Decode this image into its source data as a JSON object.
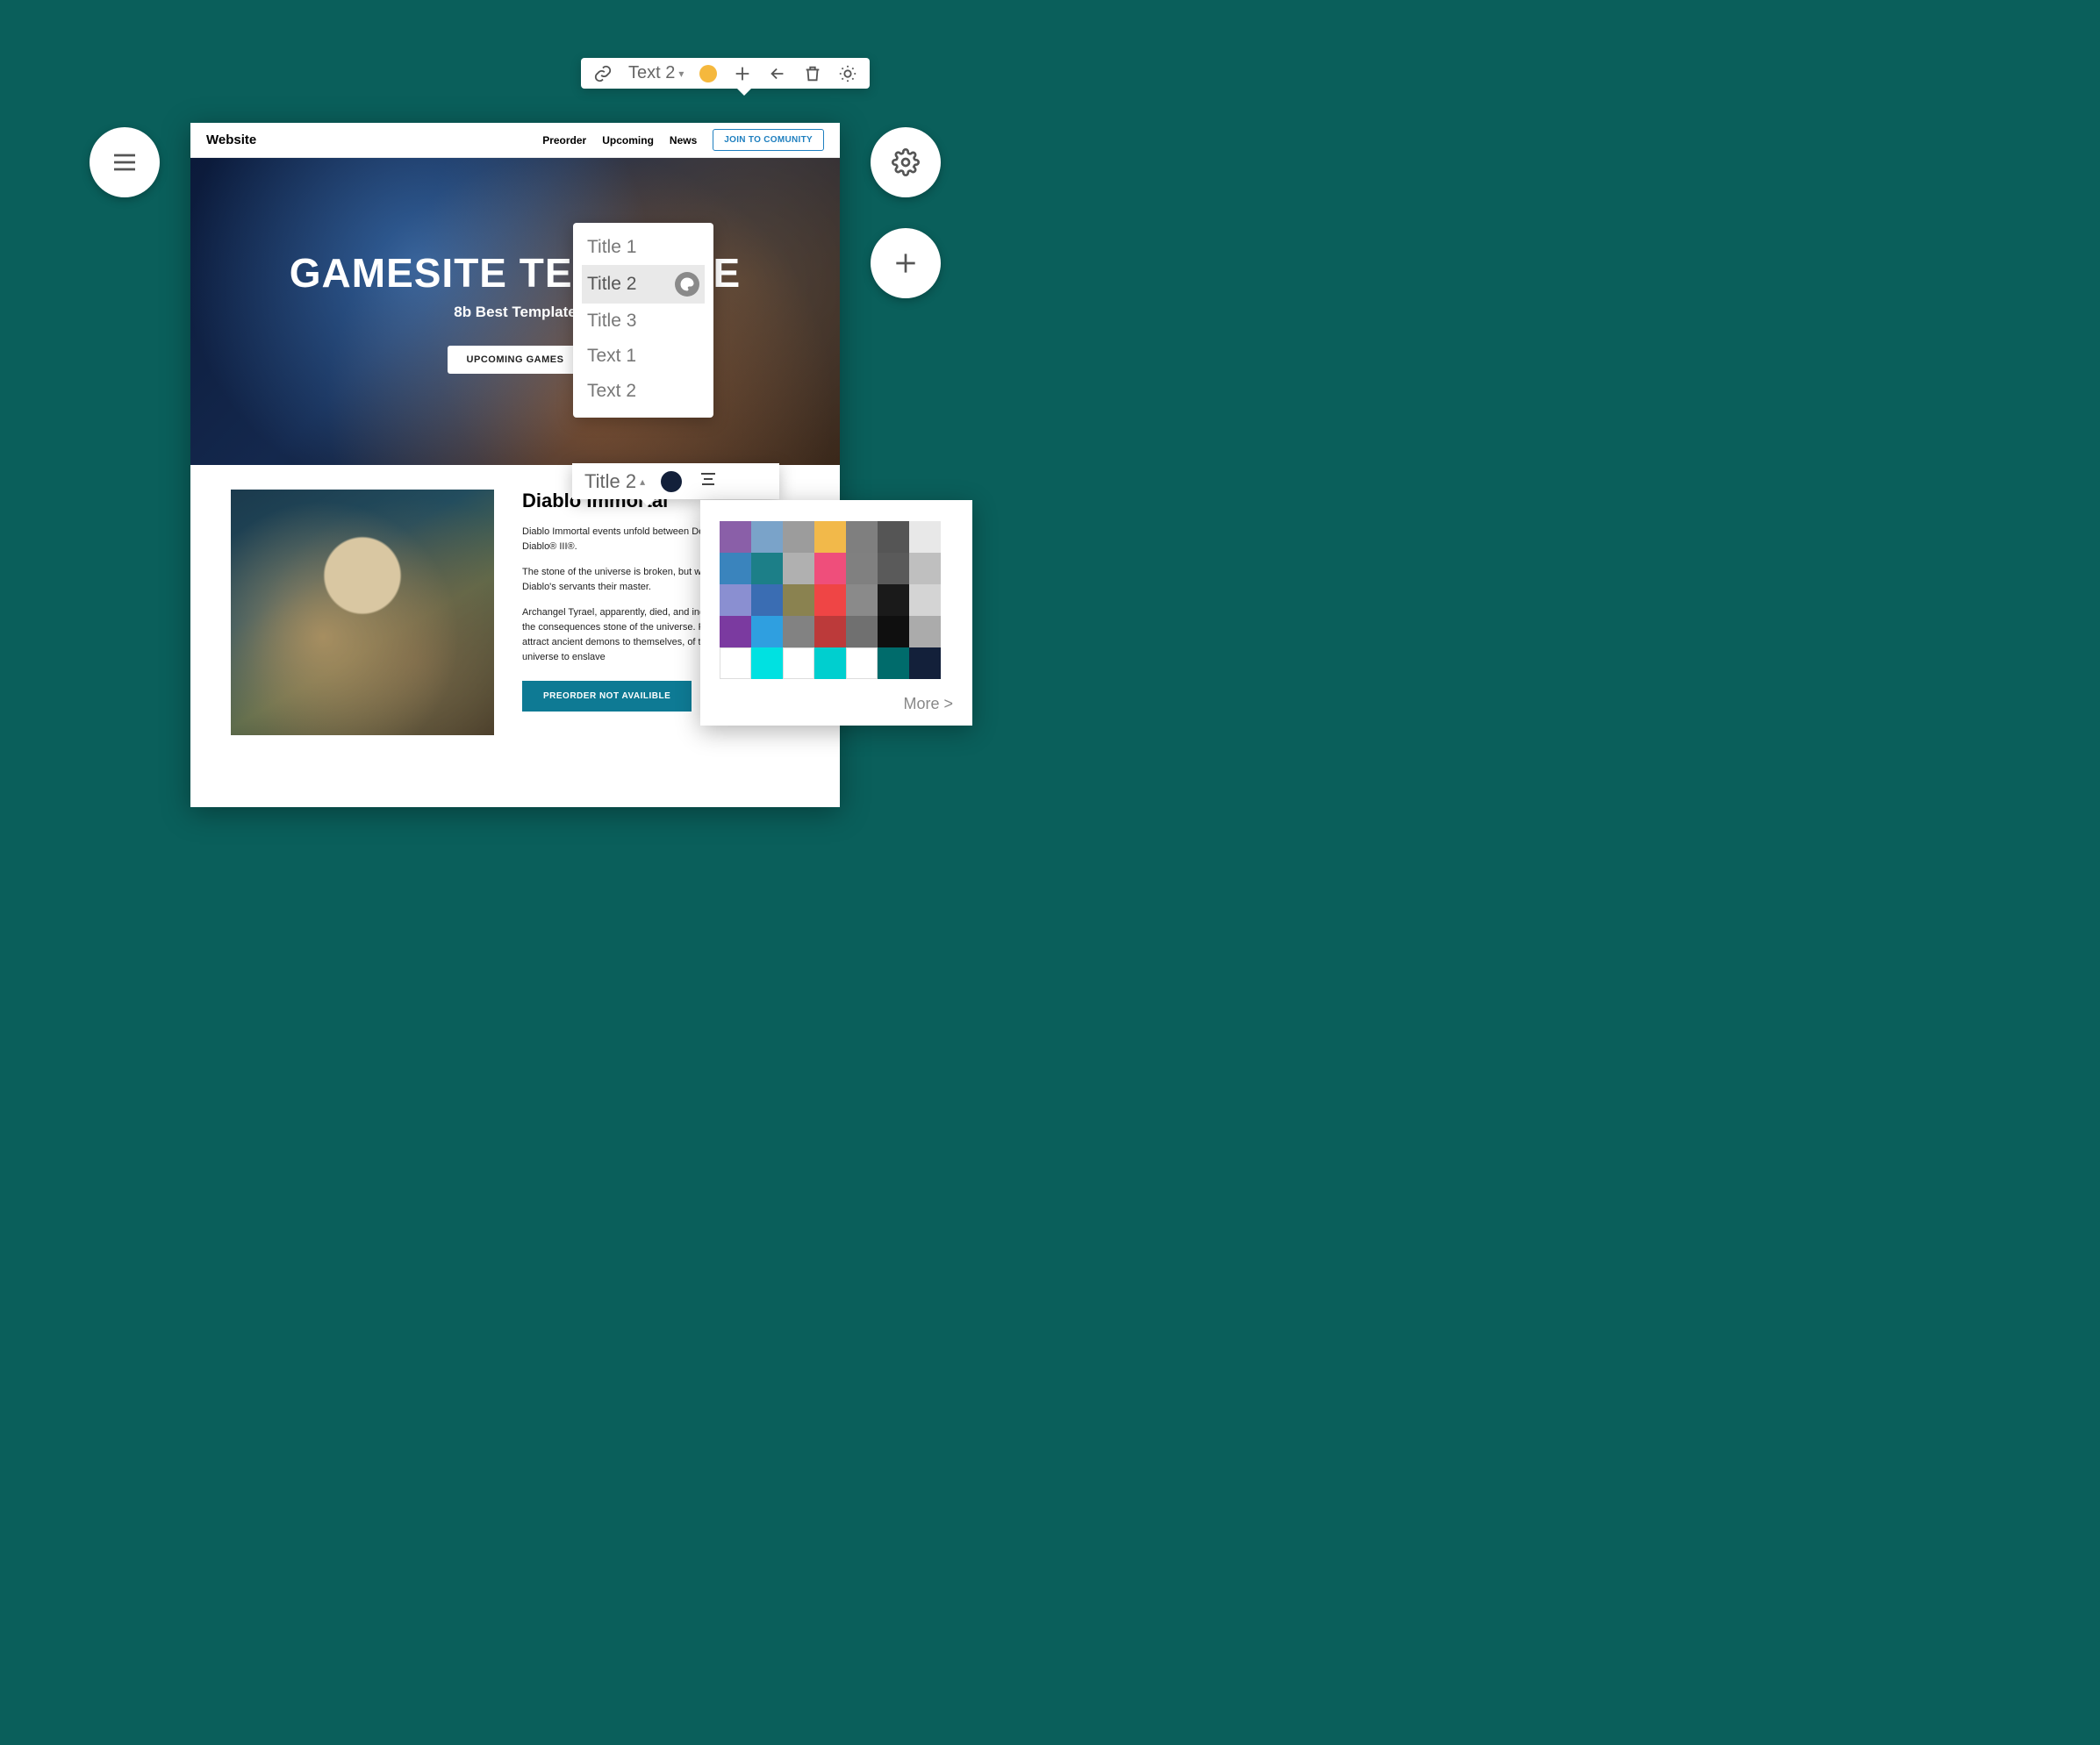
{
  "topToolbar": {
    "styleLabel": "Text 2",
    "colorDot": "#f5b83d"
  },
  "floatingButtons": {
    "menu": "menu",
    "settings": "settings",
    "add": "add"
  },
  "site": {
    "brand": "Website",
    "nav": {
      "preorder": "Preorder",
      "upcoming": "Upcoming",
      "news": "News",
      "join": "JOIN TO COMUNITY"
    },
    "hero": {
      "title": "GAMESITE TEMPLATE",
      "subtitle": "8b Best Template",
      "cta": "UPCOMING GAMES"
    },
    "article": {
      "title": "Diablo Immortal",
      "p1": "Diablo Immortal events unfold between Destruction® and Diablo® III®.",
      "p2": "The stone of the universe is broken, but with great power that Diablo's servants their master.",
      "p3": "Archangel Tyrael, apparently, died, and independently deal with the consequences stone of the universe. Fragments of stone attract ancient demons to themselves, of the stone of the universe to enslave",
      "button": "PREORDER NOT AVAILIBLE"
    }
  },
  "stylePanel": {
    "options": [
      "Title 1",
      "Title 2",
      "Title 3",
      "Text 1",
      "Text 2"
    ],
    "selectedIndex": 1
  },
  "midToolbar": {
    "label": "Title 2",
    "color": "#13203a"
  },
  "colorPanel": {
    "colors": [
      "#8a5fa8",
      "#7aa3c9",
      "#9c9c9c",
      "#f2b94a",
      "#7f7f7f",
      "#555555",
      "#e8e8e8",
      "#3a84bd",
      "#1c7f88",
      "#b0b0b0",
      "#ef4e7b",
      "#808080",
      "#5a5a5a",
      "#bfbfbf",
      "#8a8fd1",
      "#3a6db3",
      "#8a8250",
      "#ef4545",
      "#8a8a8a",
      "#1a1a1a",
      "#d4d4d4",
      "#7b3aa0",
      "#2f9fe0",
      "#828282",
      "#bc3a3a",
      "#707070",
      "#0f0f0f",
      "#ababab",
      "#ffffff",
      "#00e1e1",
      "#ffffff",
      "#00cfcf",
      "#ffffff",
      "#006b6b",
      "#13203a"
    ],
    "moreLabel": "More >"
  }
}
